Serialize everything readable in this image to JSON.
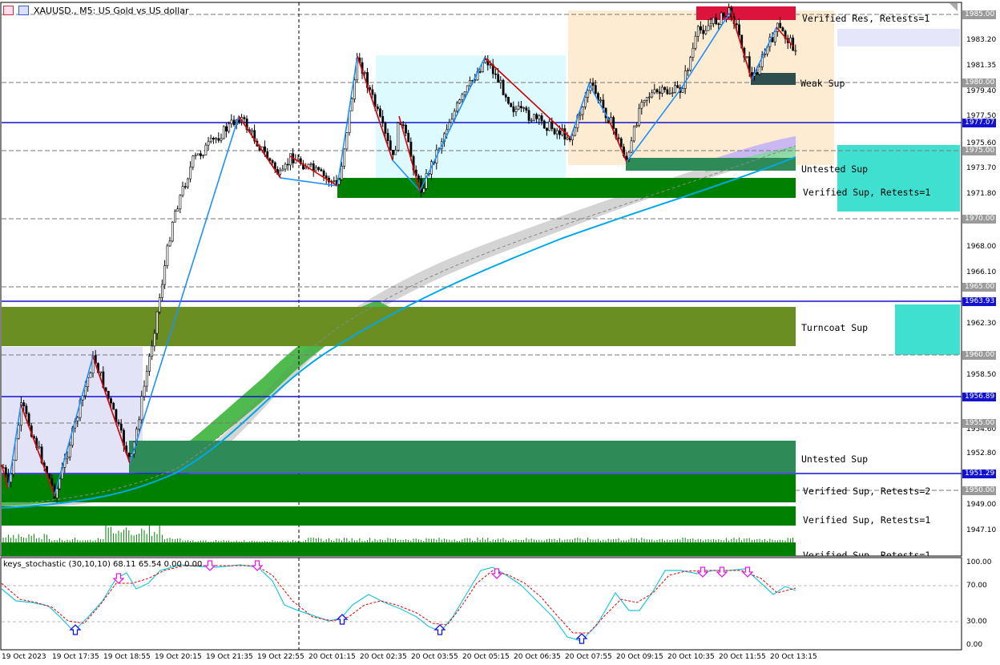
{
  "header": {
    "symbol": "XAUUSD.",
    "timeframe": "M5",
    "description": "US Gold vs US dollar",
    "title": "XAUUSD., M5:  US Gold vs US dollar"
  },
  "zones": [
    {
      "label": "Verified Res, Retests=1",
      "top": 1985.0
    },
    {
      "label": "Weak Sup",
      "top": 1980.0
    },
    {
      "label": "Untested Sup",
      "top": 1973.9
    },
    {
      "label": "Verified Sup, Retests=1",
      "top": 1972.3
    },
    {
      "label": "Turncoat Sup",
      "top": 1962.3
    },
    {
      "label": "Untested Sup",
      "top": 1952.4
    },
    {
      "label": "Verified Sup, Retests=2",
      "top": 1950.0
    },
    {
      "label": "Verified Sup, Retests=1",
      "top": 1947.8
    },
    {
      "label": "Verified Sup, Retests=1",
      "top": 1945.1
    }
  ],
  "price_axis": {
    "labels": [
      "1983.20",
      "1981.35",
      "1979.40",
      "1977.50",
      "1975.60",
      "1973.70",
      "1971.80",
      "1968.00",
      "1966.10",
      "1962.30",
      "1958.50",
      "1954.60",
      "1952.80",
      "1949.00",
      "1947.10"
    ],
    "tags_gray": [
      "1985.00",
      "1980.00",
      "1975.00",
      "1970.00",
      "1965.00",
      "1960.00",
      "1955.00",
      "1950.00"
    ],
    "tags_blue": [
      "1977.07",
      "1963.93",
      "1956.89",
      "1951.29"
    ]
  },
  "time_axis": [
    "19 Oct 2023",
    "19 Oct 17:35",
    "19 Oct 18:55",
    "19 Oct 20:15",
    "19 Oct 21:35",
    "19 Oct 22:55",
    "20 Oct 01:15",
    "20 Oct 02:35",
    "20 Oct 03:55",
    "20 Oct 05:15",
    "20 Oct 06:35",
    "20 Oct 07:55",
    "20 Oct 09:15",
    "20 Oct 10:35",
    "20 Oct 11:55",
    "20 Oct 13:15"
  ],
  "indicator": {
    "label": "keys_stochastic (30,10,10) 68.11 65.54 0.00 0.00",
    "levels": [
      "100.00",
      "70.00",
      "30.00",
      "0.00"
    ]
  },
  "colors": {
    "resistance": "#dc143c",
    "verified_sup": "#008000",
    "turncoat": "#6b8e23",
    "untested": "#2e8b57",
    "weak": "#2f4f4f",
    "hline": "#1212d0",
    "up_swing": "#1e90ff",
    "down_swing": "#e00000",
    "ma": "#00a8e8"
  }
}
